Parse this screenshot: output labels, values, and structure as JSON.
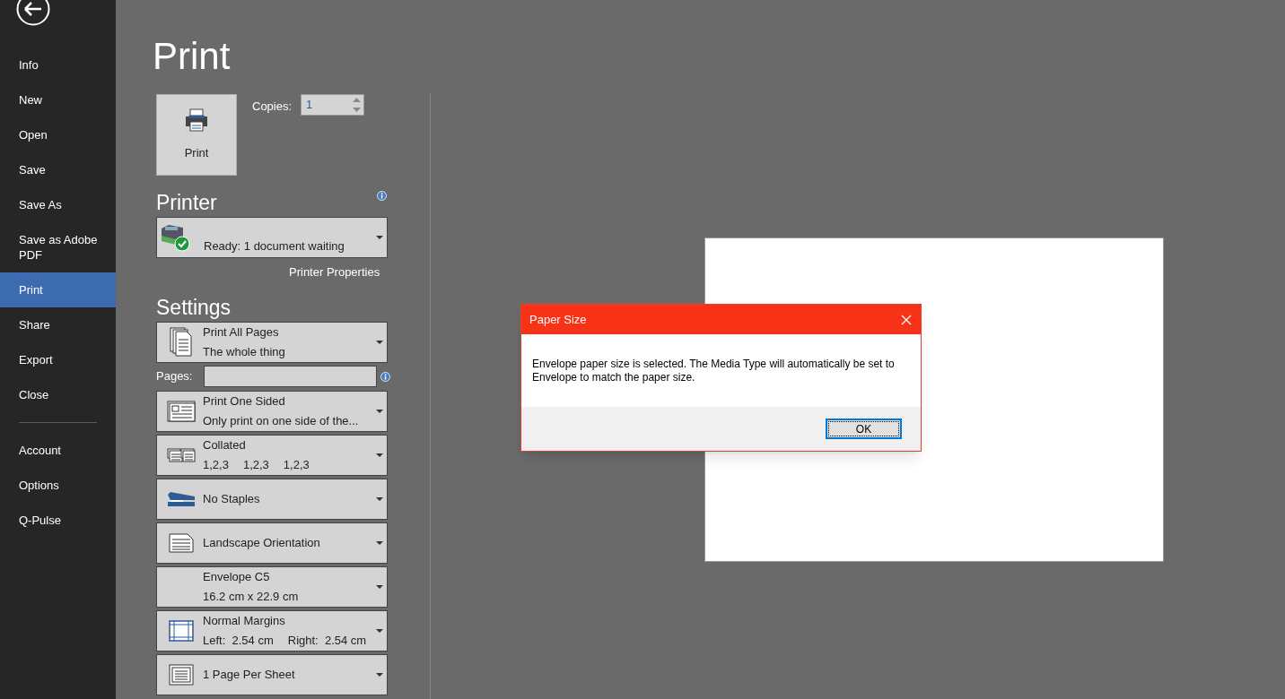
{
  "sidebar": {
    "groups": [
      [
        {
          "label": "Info",
          "selected": false
        },
        {
          "label": "New",
          "selected": false
        },
        {
          "label": "Open",
          "selected": false
        },
        {
          "label": "Save",
          "selected": false
        },
        {
          "label": "Save As",
          "selected": false
        },
        {
          "label": "Save as Adobe PDF",
          "selected": false
        },
        {
          "label": "Print",
          "selected": true
        },
        {
          "label": "Share",
          "selected": false
        },
        {
          "label": "Export",
          "selected": false
        },
        {
          "label": "Close",
          "selected": false
        }
      ],
      [
        {
          "label": "Account",
          "selected": false
        },
        {
          "label": "Options",
          "selected": false
        },
        {
          "label": "Q-Pulse",
          "selected": false
        }
      ]
    ]
  },
  "title": "Print",
  "print_button": "Print",
  "copies": {
    "label": "Copies:",
    "value": "1"
  },
  "printer": {
    "heading": "Printer",
    "status": "Ready: 1 document waiting",
    "properties_link": "Printer Properties"
  },
  "settings": {
    "heading": "Settings",
    "pages_label": "Pages:",
    "items": [
      {
        "kind": "pages",
        "title": "Print All Pages",
        "details": [
          "The whole thing"
        ]
      },
      {
        "kind": "one-sided",
        "title": "Print One Sided",
        "details": [
          "Only print on one side of the..."
        ]
      },
      {
        "kind": "collated",
        "title": "Collated",
        "details": [
          "1,2,3",
          "1,2,3",
          "1,2,3"
        ]
      },
      {
        "kind": "staples",
        "title": "No Staples"
      },
      {
        "kind": "orientation",
        "title": "Landscape Orientation"
      },
      {
        "kind": "plain",
        "title": "Envelope C5",
        "details": [
          "16.2 cm x 22.9 cm"
        ]
      },
      {
        "kind": "margins",
        "title": "Normal Margins",
        "details": [
          "Left:  2.54 cm",
          "Right:  2.54 cm"
        ]
      },
      {
        "kind": "per-sheet",
        "title": "1 Page Per Sheet"
      }
    ]
  },
  "dialog": {
    "title": "Paper Size",
    "message": "Envelope paper size is selected. The Media Type will automatically be set to Envelope to match the paper size.",
    "button": "OK"
  }
}
